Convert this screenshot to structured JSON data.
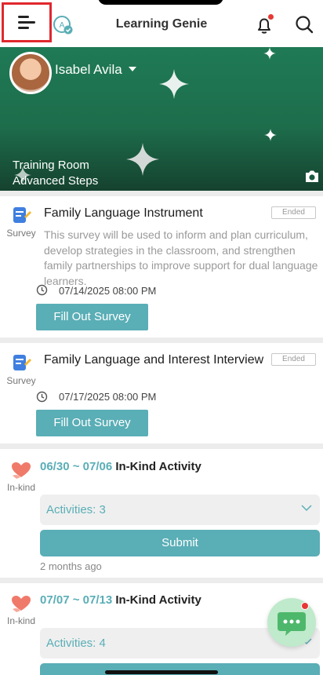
{
  "header": {
    "title": "Learning Genie",
    "icons": [
      "menu-icon",
      "language-icon",
      "bell-icon",
      "search-icon"
    ],
    "notification_dot": true
  },
  "banner": {
    "user_name": "Isabel Avila",
    "room_name": "Training Room",
    "room_sub": "Advanced Steps",
    "background_color": "#1f7a55"
  },
  "surveys": [
    {
      "title": "Family Language Instrument",
      "status": "Ended",
      "type_caption": "Survey",
      "description": "This survey will be used to inform and plan curriculum, develop strategies in the classroom, and strengthen family partnerships to improve support for dual language learners.",
      "date": "07/14/2025 08:00 PM",
      "button_label": "Fill Out Survey"
    },
    {
      "title": "Family Language and Interest Interview",
      "status": "Ended",
      "type_caption": "Survey",
      "description": "",
      "date": "07/17/2025 08:00 PM",
      "button_label": "Fill Out Survey"
    }
  ],
  "in_kind": [
    {
      "type_caption": "In-kind",
      "date_range": "06/30 ~ 07/06",
      "label": "In-Kind Activity",
      "activities": "Activities: 3",
      "submit_label": "Submit",
      "time_ago": "2 months ago"
    },
    {
      "type_caption": "In-kind",
      "date_range": "07/07 ~ 07/13",
      "label": "In-Kind Activity",
      "activities": "Activities: 4"
    }
  ],
  "colors": {
    "accent": "#5aaeb6",
    "alert": "#e53935",
    "highlight_box": "#e0282e"
  }
}
